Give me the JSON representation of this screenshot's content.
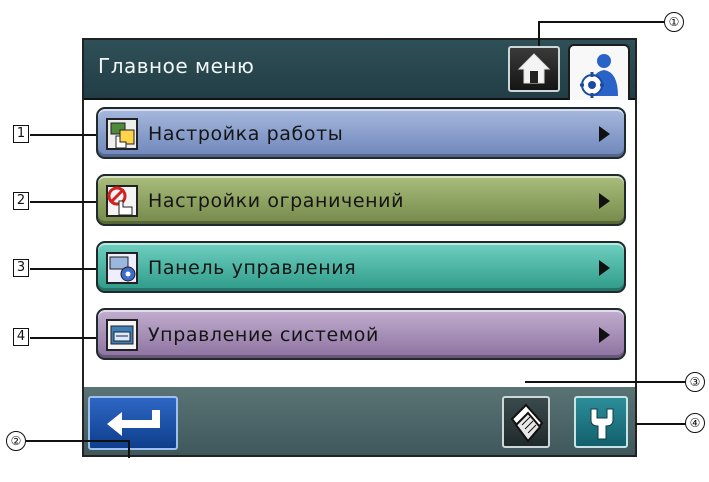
{
  "header": {
    "title": "Главное меню"
  },
  "menu": [
    {
      "label": "Настройка работы",
      "color": "#7b92c4",
      "icon": "job-setting-icon"
    },
    {
      "label": "Настройки ограничений",
      "color": "#839a57",
      "icon": "restriction-icon"
    },
    {
      "label": "Панель управления",
      "color": "#3fb2a0",
      "icon": "control-panel-icon"
    },
    {
      "label": "Управление системой",
      "color": "#9f86b1",
      "icon": "system-management-icon"
    }
  ],
  "callouts": {
    "boxes": [
      "1",
      "2",
      "3",
      "4"
    ],
    "circles": [
      "①",
      "②",
      "③",
      "④"
    ]
  },
  "colors": {
    "header": "#2b4a52",
    "footer": "#4e686b",
    "back_button": "#1a4fa6",
    "wrench_button": "#1e7a86"
  }
}
